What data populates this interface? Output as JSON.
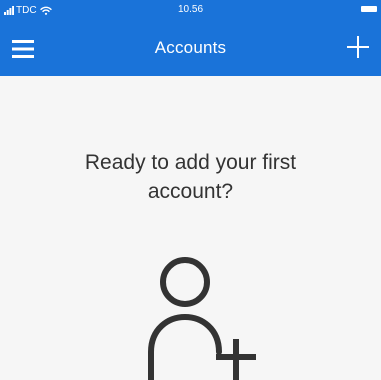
{
  "status_bar": {
    "carrier": "TDC",
    "time": "10.56"
  },
  "app_bar": {
    "title": "Accounts",
    "menu_icon": "hamburger-menu-icon",
    "add_icon": "plus-icon"
  },
  "empty_state": {
    "title": "Ready to add your first account?",
    "icon": "add-person-icon"
  },
  "colors": {
    "accent": "#1a73d9",
    "background": "#f6f6f6",
    "text": "#333333",
    "icon": "#333333"
  }
}
